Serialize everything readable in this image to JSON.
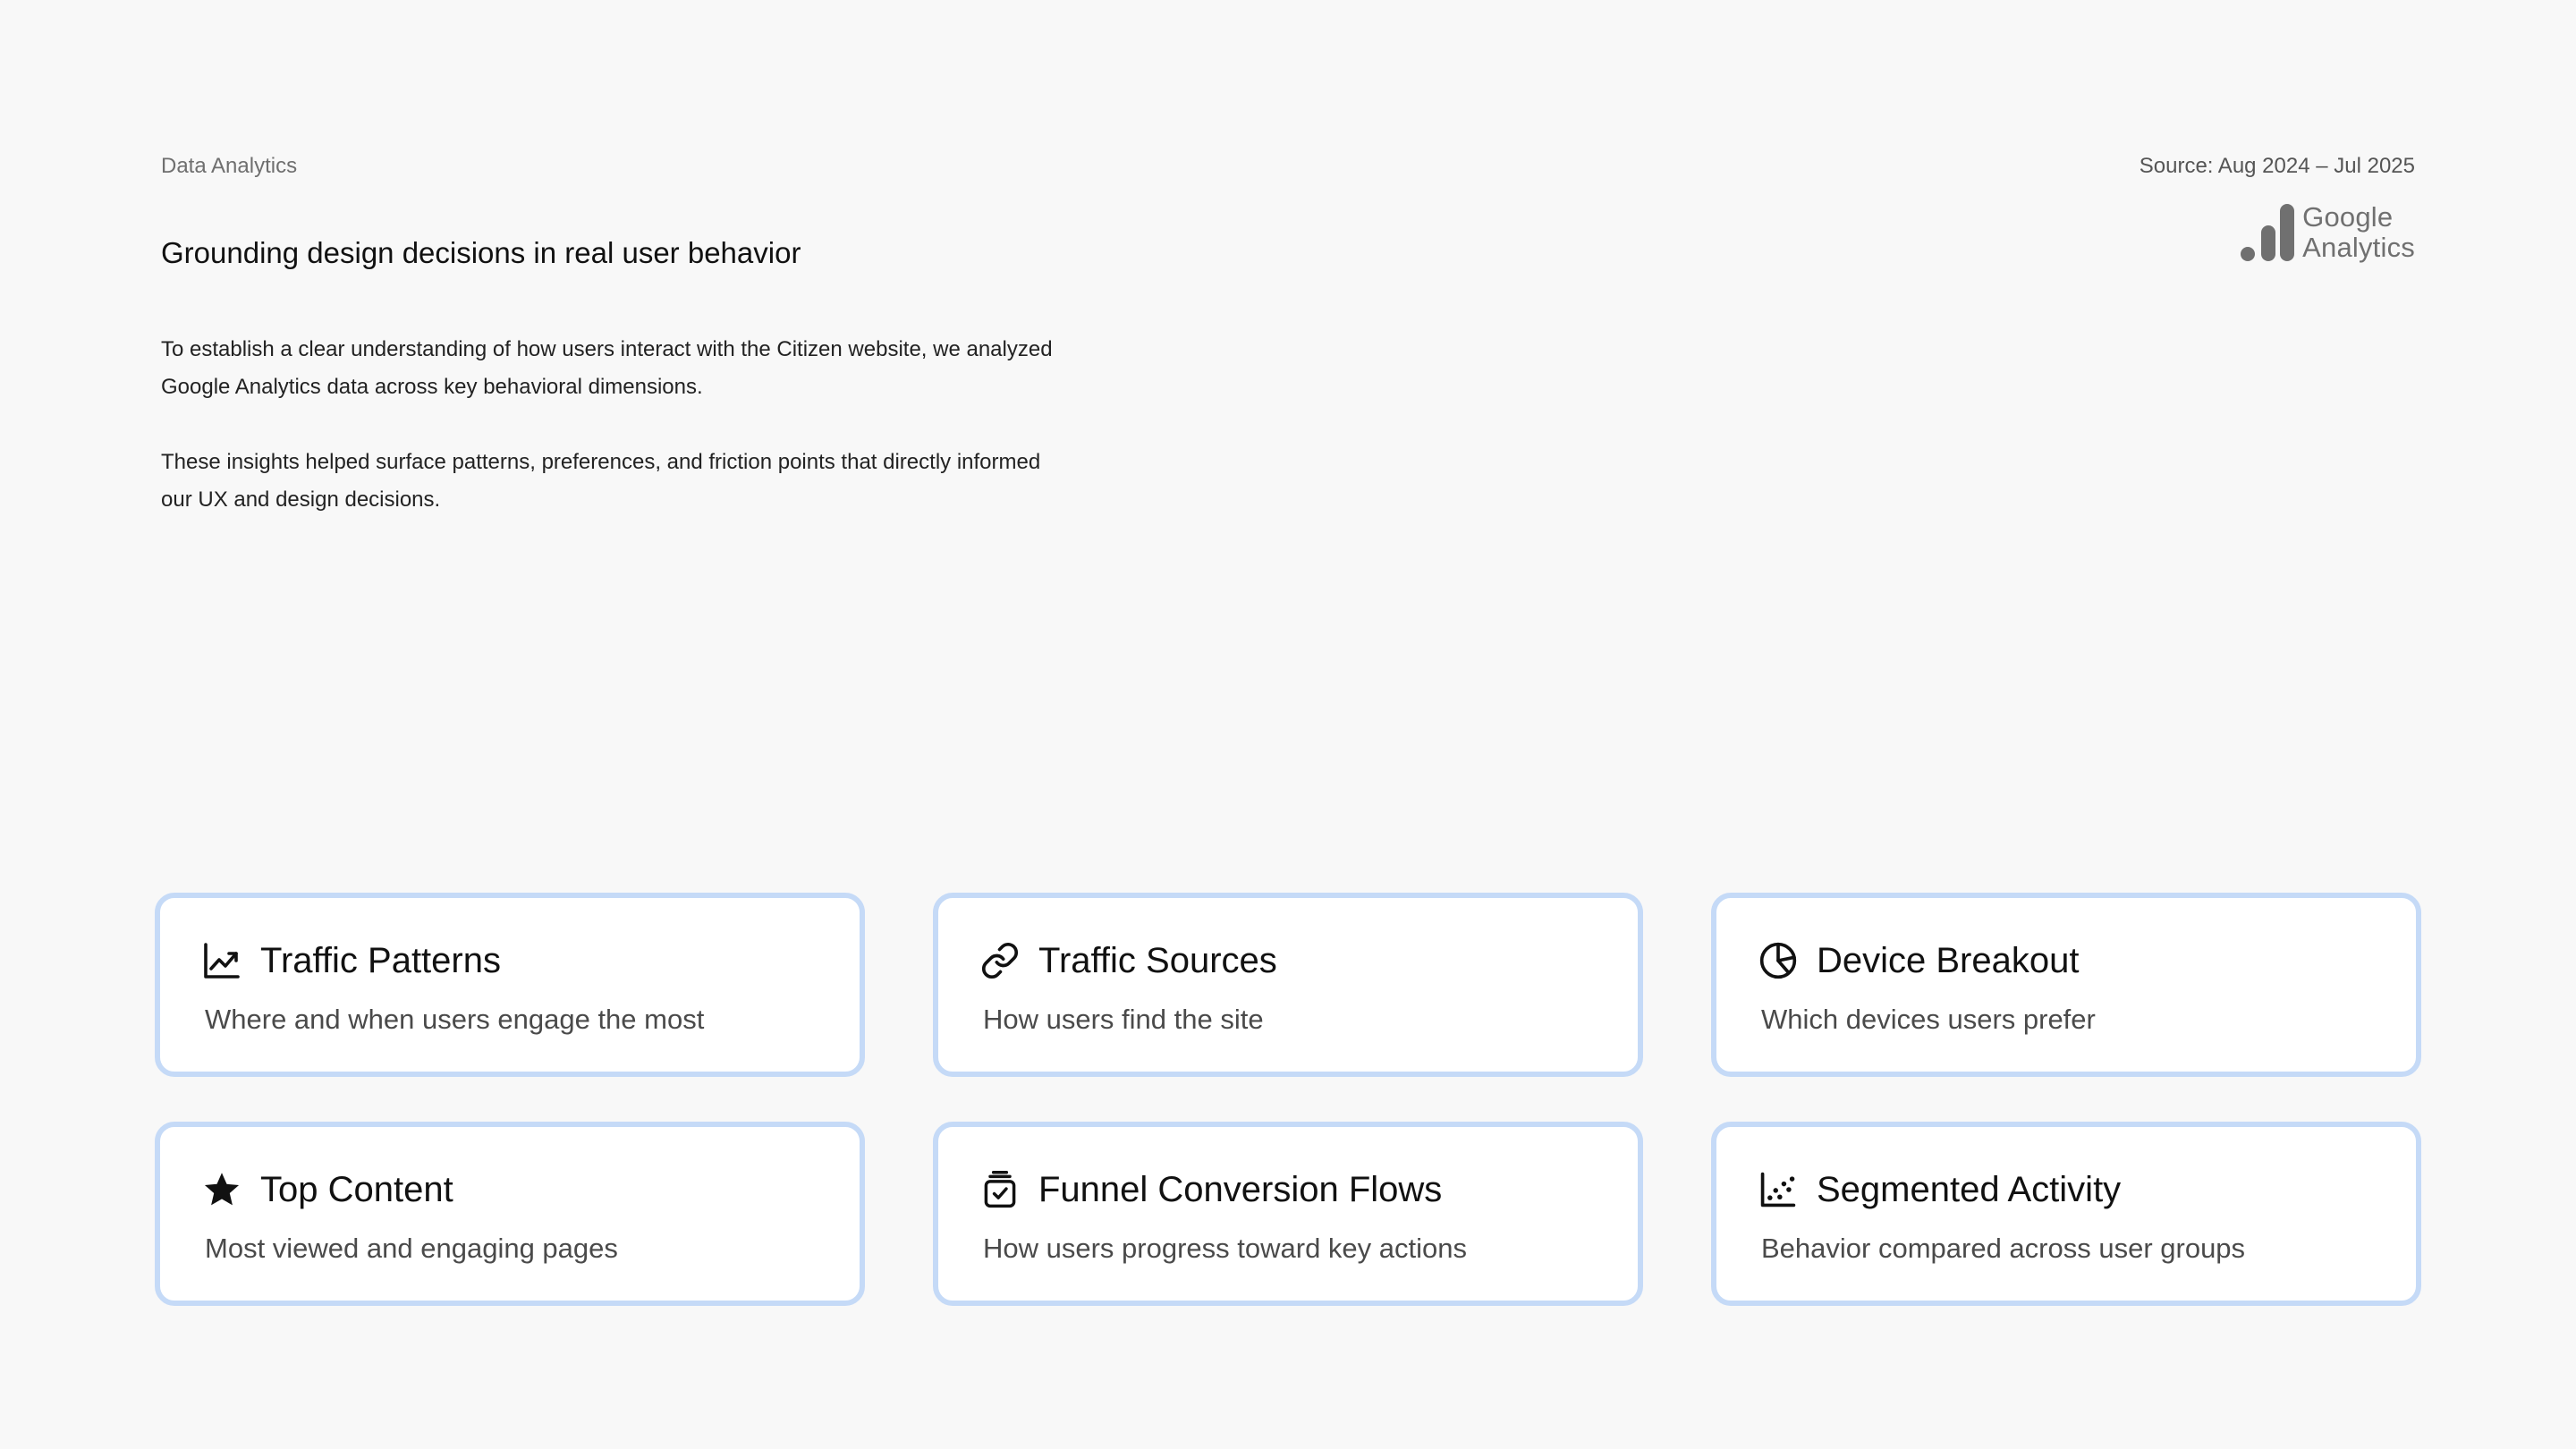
{
  "header": {
    "eyebrow": "Data Analytics",
    "source": "Source: Aug 2024 – Jul 2025",
    "logo": {
      "line1": "Google",
      "line2": "Analytics",
      "icon": "google-analytics-bars-icon"
    },
    "title": "Grounding design decisions in real user behavior"
  },
  "intro": {
    "paragraph1": "To establish a clear understanding of how users interact with the Citizen website, we analyzed Google Analytics data across key behavioral dimensions.",
    "paragraph2": "These insights helped surface patterns, preferences, and friction points that directly informed our UX and design decisions."
  },
  "colors": {
    "background": "#f8f8f8",
    "card_border": "#c5daf7",
    "card_background": "#ffffff",
    "title_text": "#111111",
    "muted_text": "#4a4a4a"
  },
  "cards": [
    {
      "icon": "trending-up-icon",
      "title": "Traffic Patterns",
      "description": "Where and when users engage the most"
    },
    {
      "icon": "link-icon",
      "title": "Traffic Sources",
      "description": "How users find the site"
    },
    {
      "icon": "pie-chart-icon",
      "title": "Device Breakout",
      "description": "Which devices users prefer"
    },
    {
      "icon": "star-icon",
      "title": "Top Content",
      "description": "Most viewed and engaging pages"
    },
    {
      "icon": "checklist-stack-icon",
      "title": "Funnel Conversion Flows",
      "description": "How users progress toward key actions"
    },
    {
      "icon": "scatter-chart-icon",
      "title": "Segmented Activity",
      "description": "Behavior compared across user groups"
    }
  ]
}
